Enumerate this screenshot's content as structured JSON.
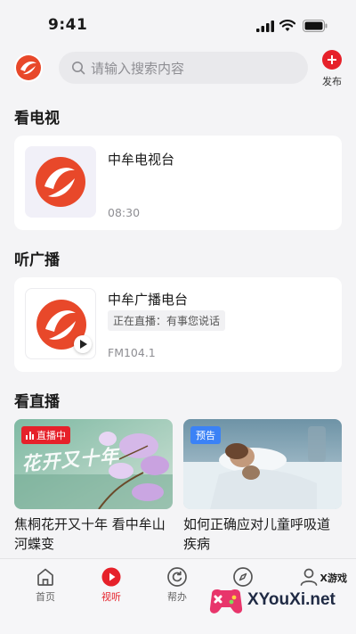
{
  "status_bar": {
    "time": "9:41"
  },
  "header": {
    "search_placeholder": "请输入搜索内容",
    "publish_label": "发布"
  },
  "tv": {
    "title": "看电视",
    "station": "中牟电视台",
    "time": "08:30"
  },
  "radio": {
    "title": "听广播",
    "station": "中牟广播电台",
    "now_playing": "正在直播：有事您说话",
    "frequency": "FM104.1"
  },
  "live": {
    "title": "看直播",
    "items": [
      {
        "badge": "直播中",
        "title": "焦桐花开又十年 看中牟山河蝶变",
        "overlay": "花开又十年"
      },
      {
        "badge": "预告",
        "title": "如何正确应对儿童呼吸道疾病"
      }
    ]
  },
  "nav": {
    "items": [
      {
        "label": "首页"
      },
      {
        "label": "视听"
      },
      {
        "label": "帮办"
      },
      {
        "label": ""
      },
      {
        "label": ""
      }
    ]
  },
  "watermark": {
    "small": "X游戏",
    "big": "XYouXi.net"
  },
  "colors": {
    "accent": "#e6212a",
    "preview": "#3b82f6",
    "background": "#f4f4f6"
  }
}
